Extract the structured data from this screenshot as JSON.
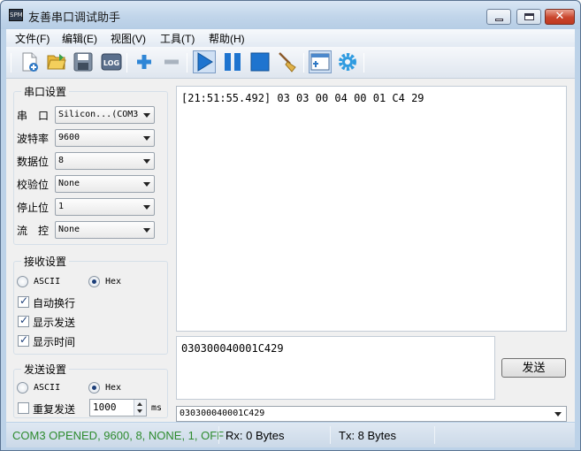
{
  "window": {
    "app_icon_text": "SPM",
    "title": "友善串口调试助手",
    "minimize_glyph": "",
    "maximize_glyph": "",
    "close_glyph": "✕"
  },
  "menu": [
    {
      "label": "文件(F)"
    },
    {
      "label": "编辑(E)"
    },
    {
      "label": "视图(V)"
    },
    {
      "label": "工具(T)"
    },
    {
      "label": "帮助(H)"
    }
  ],
  "toolbar": {
    "log_label": "LOG",
    "icons": [
      "new-file-icon",
      "open-icon",
      "save-icon",
      "log-icon",
      "add-icon",
      "remove-icon",
      "play-icon",
      "pause-icon",
      "stop-icon",
      "clear-broom-icon",
      "window-icon",
      "settings-gear-icon"
    ]
  },
  "serial": {
    "title": "串口设置",
    "port_label": "串　口",
    "port_value": "Silicon...(COM3",
    "baud_label": "波特率",
    "baud_value": "9600",
    "databits_label": "数据位",
    "databits_value": "8",
    "parity_label": "校验位",
    "parity_value": "None",
    "stopbits_label": "停止位",
    "stopbits_value": "1",
    "flow_label": "流　控",
    "flow_value": "None"
  },
  "receive": {
    "title": "接收设置",
    "ascii_label": "ASCII",
    "hex_label": "Hex",
    "mode_selected": "Hex",
    "autowrap_label": "自动换行",
    "autowrap_checked": true,
    "show_send_label": "显示发送",
    "show_send_checked": true,
    "show_time_label": "显示时间",
    "show_time_checked": true
  },
  "send": {
    "title": "发送设置",
    "ascii_label": "ASCII",
    "hex_label": "Hex",
    "mode_selected": "Hex",
    "repeat_label": "重复发送",
    "repeat_checked": false,
    "interval_value": "1000",
    "interval_unit": "ms"
  },
  "receive_area": {
    "content": "[21:51:55.492] 03 03 00 04 00 01 C4 29"
  },
  "send_area": {
    "content": "030300040001C429",
    "send_button": "发送",
    "history_value": "030300040001C429"
  },
  "status": {
    "port_status": "COM3 OPENED, 9600, 8, NONE, 1, OFF",
    "port_status_color": "#2e8b2e",
    "rx": "Rx: 0 Bytes",
    "tx": "Tx: 8 Bytes"
  }
}
